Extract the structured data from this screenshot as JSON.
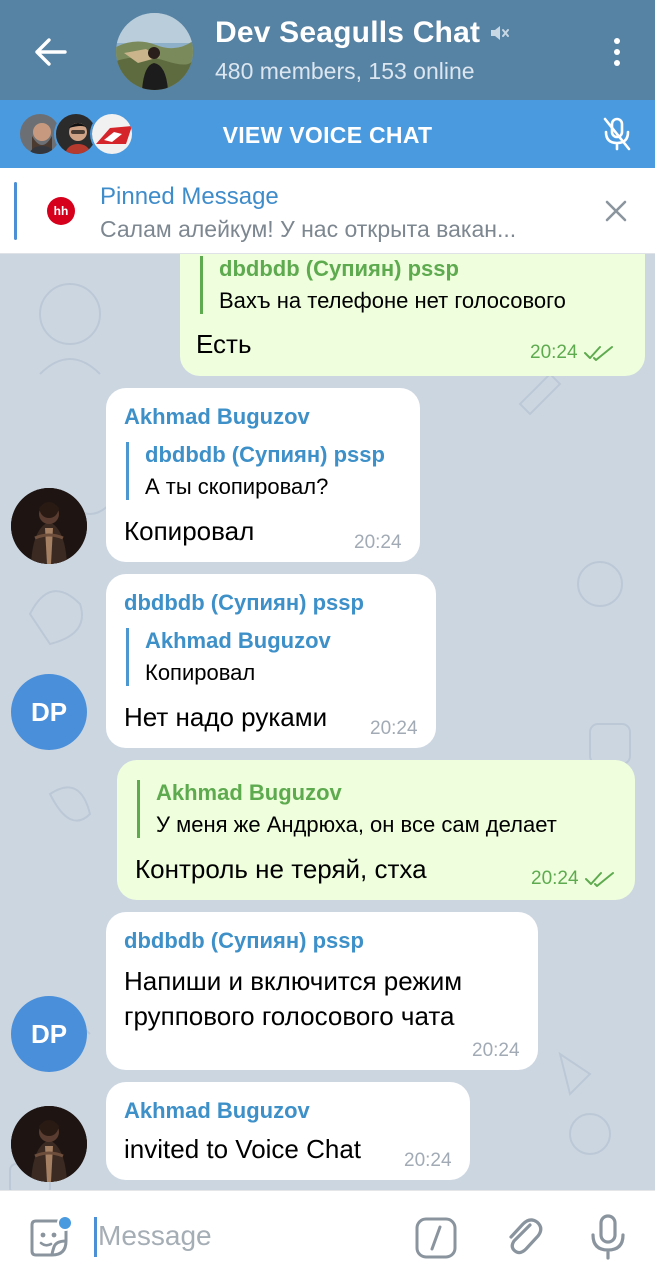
{
  "header": {
    "title": "Dev Seagulls Chat",
    "subtitle": "480 members, 153 online",
    "muted": true
  },
  "voice_bar": {
    "label": "VIEW VOICE CHAT"
  },
  "pinned": {
    "title": "Pinned Message",
    "text": "Салам алейкум!  У нас открыта вакан...",
    "badge": "hh"
  },
  "messages": [
    {
      "dir": "out",
      "reply_name": "dbdbdb (Супиян) pssp",
      "reply_text": "Вахъ на телефоне нет голосового",
      "text": "Есть",
      "time": "20:24"
    },
    {
      "dir": "in",
      "sender": "Akhmad Buguzov",
      "reply_name": "dbdbdb (Супиян) pssp",
      "reply_text": "А ты скопировал?",
      "text": "Копировал",
      "time": "20:24"
    },
    {
      "dir": "in",
      "sender": "dbdbdb (Супиян) pssp",
      "reply_name": "Akhmad Buguzov",
      "reply_text": "Копировал",
      "text": "Нет надо руками",
      "time": "20:24",
      "avatar": "DP"
    },
    {
      "dir": "out",
      "reply_name": "Akhmad Buguzov",
      "reply_text": "У меня же Андрюха, он все сам делает",
      "text": "Контроль не теряй, стха",
      "time": "20:24"
    },
    {
      "dir": "in",
      "sender": "dbdbdb (Супиян) pssp",
      "text_line1": "Напиши и включится режим",
      "text_line2": "группового голосового чата",
      "time": "20:24",
      "avatar": "DP"
    },
    {
      "dir": "in",
      "sender": "Akhmad Buguzov",
      "text": "invited to Voice Chat",
      "time": "20:24"
    }
  ],
  "composer": {
    "placeholder": "Message"
  },
  "colors": {
    "header": "#5682a3",
    "voice_bar": "#4a9ae0",
    "outgoing_bubble": "#effedd",
    "incoming_bubble": "#ffffff",
    "link_blue": "#3d90c8",
    "green": "#5eab4f"
  }
}
